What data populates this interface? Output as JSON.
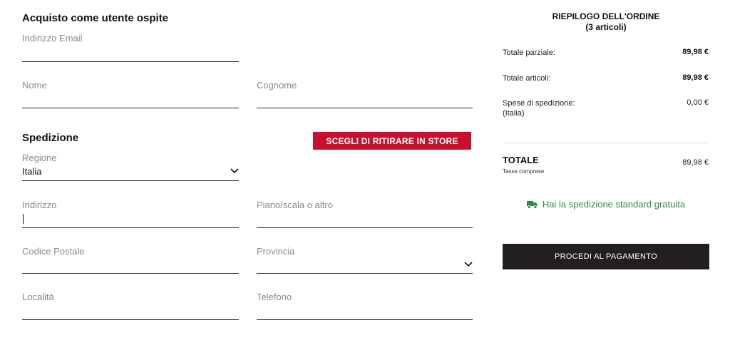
{
  "guest": {
    "title": "Acquisto come utente ospite"
  },
  "fields": {
    "email": {
      "label": "Indirizzo Email",
      "value": ""
    },
    "first_name": {
      "label": "Nome",
      "value": ""
    },
    "last_name": {
      "label": "Cognome",
      "value": ""
    },
    "region": {
      "label": "Regione",
      "value": "Italia"
    },
    "address": {
      "label": "Indirizzo",
      "value": ""
    },
    "address2": {
      "label": "Piano/scala o altro",
      "value": ""
    },
    "postal_code": {
      "label": "Codice Postale",
      "value": ""
    },
    "province": {
      "label": "Provincia",
      "value": ""
    },
    "city": {
      "label": "Località",
      "value": ""
    },
    "phone": {
      "label": "Telefono",
      "value": ""
    }
  },
  "shipping": {
    "title": "Spedizione",
    "store_pickup_button": "SCEGLI DI RITIRARE IN STORE"
  },
  "summary": {
    "title_line1": "RIEPILOGO DELL'ORDINE",
    "title_line2": "(3 articoli)",
    "subtotal_label": "Totale parziale:",
    "subtotal_value": "89,98 €",
    "items_total_label": "Totale articoli:",
    "items_total_value": "89,98 €",
    "shipping_label_line1": "Spese di spedizione:",
    "shipping_label_line2": "(Italia)",
    "shipping_value": "0,00 €",
    "total_label": "TOTALE",
    "tax_note": "Tasse comprese",
    "total_value": "89,98 €",
    "free_shipping_note": "Hai la spedizione standard gratuita",
    "free_shipping_icon": "truck-icon",
    "pay_button": "PROCEDI AL PAGAMENTO"
  },
  "colors": {
    "accent_red": "#c8102e",
    "dark_button": "#231f20",
    "success_green": "#2e8b3a"
  }
}
